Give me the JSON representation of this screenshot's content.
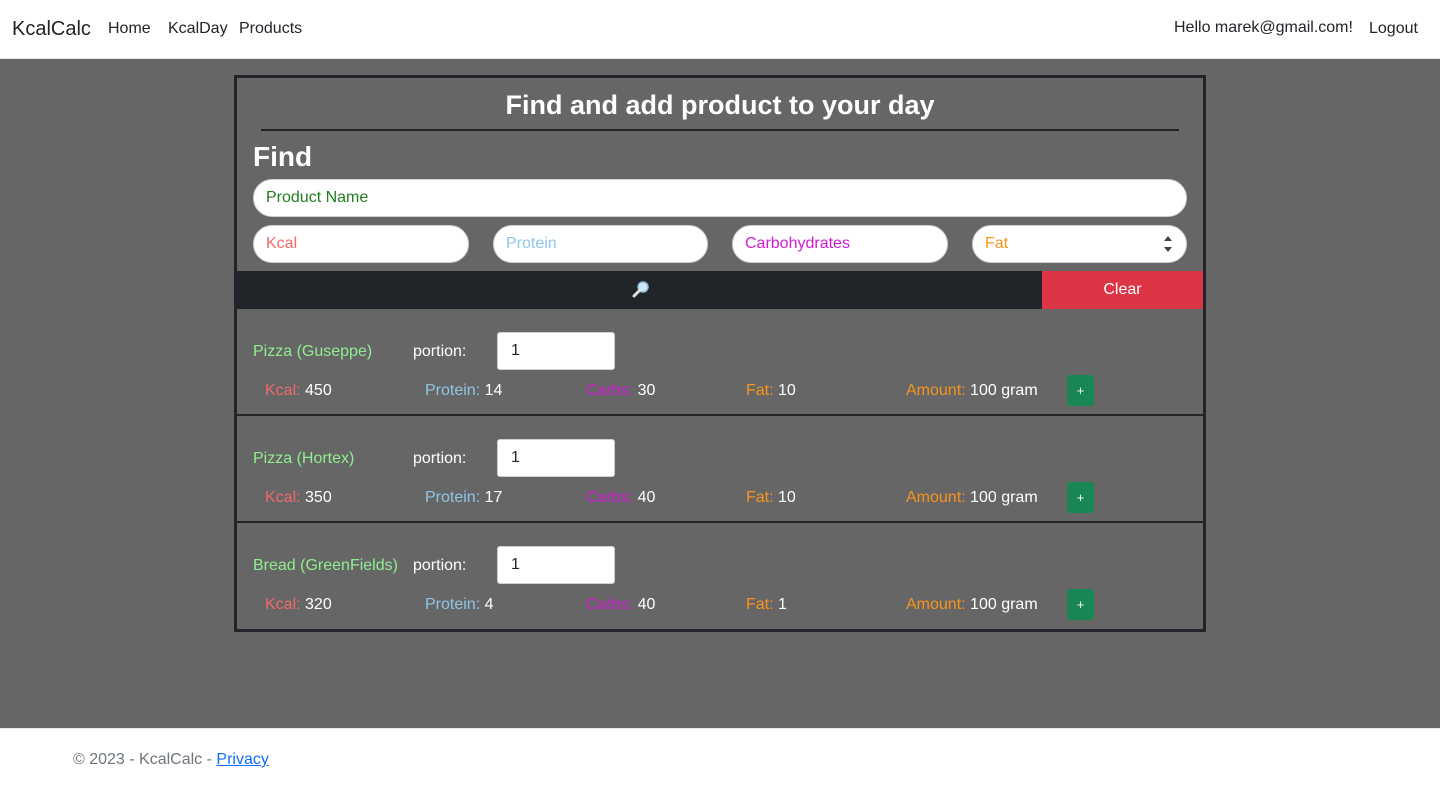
{
  "nav": {
    "brand": "KcalCalc",
    "links": [
      "Home",
      "KcalDay",
      "Products"
    ],
    "greeting": "Hello marek@gmail.com!",
    "logout": "Logout"
  },
  "panel": {
    "title": "Find and add product to your day",
    "find_heading": "Find"
  },
  "search": {
    "product_name_placeholder": "Product Name",
    "kcal_placeholder": "Kcal",
    "protein_placeholder": "Protein",
    "carbs_placeholder": "Carbohydrates",
    "fat_placeholder": "Fat",
    "search_icon": "magnifier-icon",
    "clear_label": "Clear"
  },
  "labels": {
    "portion": "portion:",
    "kcal": "Kcal:",
    "protein": "Protein:",
    "carbs": "Carbs:",
    "fat": "Fat:",
    "amount": "Amount:",
    "add": "+"
  },
  "products": [
    {
      "name": "Pizza (Guseppe)",
      "portion": "1",
      "kcal": "450",
      "protein": "14",
      "carbs": "30",
      "fat": "10",
      "amount": "100 gram"
    },
    {
      "name": "Pizza (Hortex)",
      "portion": "1",
      "kcal": "350",
      "protein": "17",
      "carbs": "40",
      "fat": "10",
      "amount": "100 gram"
    },
    {
      "name": "Bread (GreenFields)",
      "portion": "1",
      "kcal": "320",
      "protein": "4",
      "carbs": "40",
      "fat": "1",
      "amount": "100 gram"
    }
  ],
  "footer": {
    "text": "© 2023 - KcalCalc - ",
    "privacy": "Privacy"
  },
  "colors": {
    "page_bg": "#666666",
    "dark": "#212529",
    "danger": "#dc3545",
    "success": "#198754",
    "product_name": "#90ee90"
  }
}
